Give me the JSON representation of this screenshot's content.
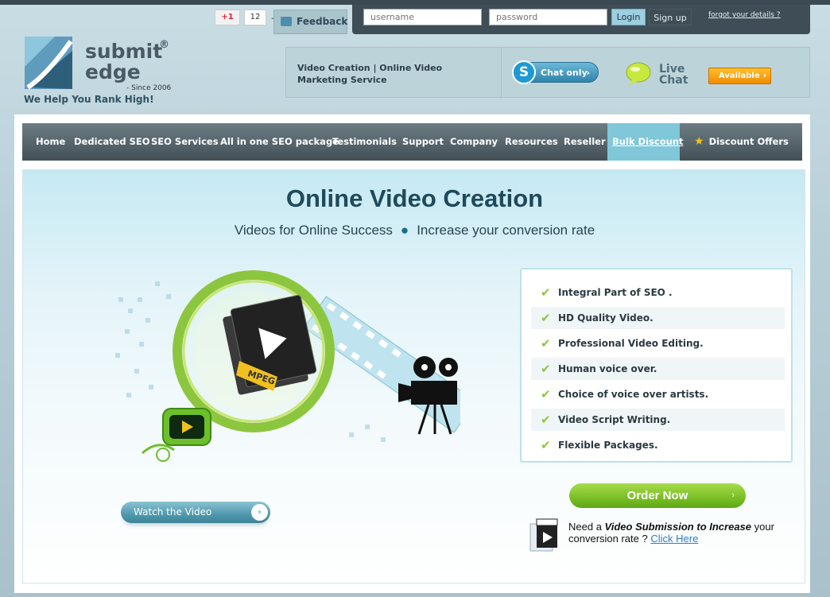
{
  "social": {
    "gplus_label": "+1",
    "gplus_count": "12",
    "separator": "-",
    "feedback": "Feedback"
  },
  "login": {
    "username_placeholder": "username",
    "password_placeholder": "password",
    "login_label": "Login",
    "signup_label": "Sign up",
    "forgot_label": "forgot your details ?"
  },
  "logo": {
    "line1": "submit",
    "line2": "edge",
    "reg": "®",
    "since": "- Since 2006",
    "tagline": "We Help You Rank High!"
  },
  "header": {
    "info_text": "Video Creation  | Online Video Marketing Service",
    "chat_only": "Chat only",
    "live_chat_line1": "Live",
    "live_chat_line2": "Chat",
    "available": "Available"
  },
  "nav": {
    "items": [
      "Home",
      "Dedicated SEO",
      "SEO Services",
      "All in one SEO package",
      "Testimonials",
      "Support",
      "Company",
      "Resources",
      "Reseller",
      "Bulk Discount"
    ],
    "discount_offers": "Discount Offers"
  },
  "hero": {
    "title": "Online Video Creation",
    "sub_left": "Videos for Online Success",
    "sub_dot": "●",
    "sub_right": "Increase your conversion rate",
    "mpeg_label": "MPEG"
  },
  "features": [
    "Integral Part of SEO .",
    "HD Quality Video.",
    "Professional Video Editing.",
    "Human voice over.",
    "Choice of voice over artists.",
    "Video Script Writing.",
    "Flexible Packages."
  ],
  "cta": {
    "order_now": "Order Now",
    "watch_video": "Watch the Video",
    "need_a": "Need a ",
    "submission_bold": "Video Submission to Increase",
    "submission_rest": " your conversion rate ? ",
    "click_here": "Click Here"
  },
  "colors": {
    "accent_blue": "#1e4a5c",
    "nav_active": "#7fc7d9",
    "order_green": "#7cc128",
    "available_orange": "#f08c00"
  }
}
